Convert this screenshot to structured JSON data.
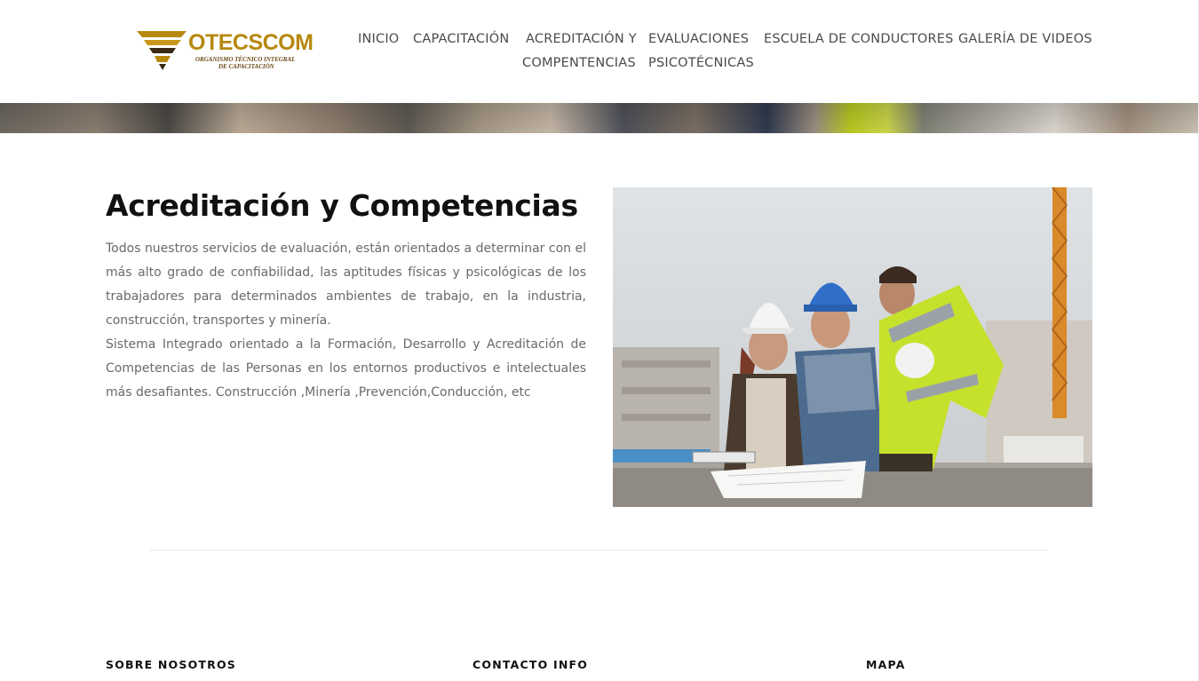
{
  "brand": {
    "name": "OTECSCOM",
    "subtitle_line1": "ORGANISMO TÉCNICO INTEGRAL",
    "subtitle_line2": "DE CAPACITACIÓN",
    "color": "#b7880e"
  },
  "nav": {
    "items": [
      {
        "label": "INICIO"
      },
      {
        "label": "CAPACITACIÓN"
      },
      {
        "label_line1": "ACREDITACIÓN Y",
        "label_line2": "COMPENTENCIAS"
      },
      {
        "label_line1": "EVALUACIONES",
        "label_line2": "PSICOTÉCNICAS"
      },
      {
        "label": "ESCUELA DE CONDUCTORES"
      },
      {
        "label": "GALERÍA DE VIDEOS"
      }
    ]
  },
  "main": {
    "title": "Acreditación y Competencias",
    "paragraph1": "Todos nuestros servicios de evaluación, están orientados a determinar con el más alto grado de confiabilidad, las aptitudes físicas y psicológicas de los trabajadores para determinados ambientes de trabajo, en la industria, construcción, transportes y minería.",
    "paragraph2": "Sistema Integrado orientado a la Formación, Desarrollo y Acreditación de Competencias de las Personas en los entornos productivos e intelectuales más desafiantes. Construcción ,Minería ,Prevención,Conducción, etc",
    "photo_icon": "construction-workers-photo"
  },
  "footer": {
    "col1_heading": "SOBRE NOSOTROS",
    "col2_heading": "CONTACTO INFO",
    "col3_heading": "MAPA"
  }
}
